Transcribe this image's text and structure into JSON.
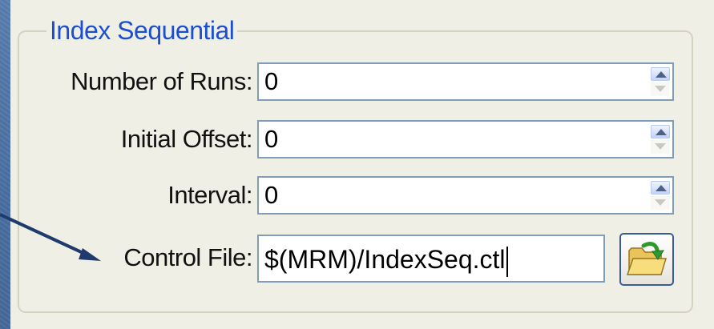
{
  "group": {
    "title": "Index Sequential"
  },
  "fields": {
    "runs": {
      "label": "Number of Runs:",
      "value": "0"
    },
    "offset": {
      "label": "Initial Offset:",
      "value": "0"
    },
    "interval": {
      "label": "Interval:",
      "value": "0"
    },
    "control_file": {
      "label": "Control File:",
      "value": "$(MRM)/IndexSeq.ctl"
    }
  },
  "icons": {
    "spin_up": "spin-up-icon",
    "spin_down": "spin-down-icon",
    "browse": "folder-open-icon",
    "callout": "arrow-pointer"
  },
  "colors": {
    "legend_text": "#1a4fd0",
    "field_border": "#7f9db9",
    "arrow": "#1f3b6e"
  }
}
